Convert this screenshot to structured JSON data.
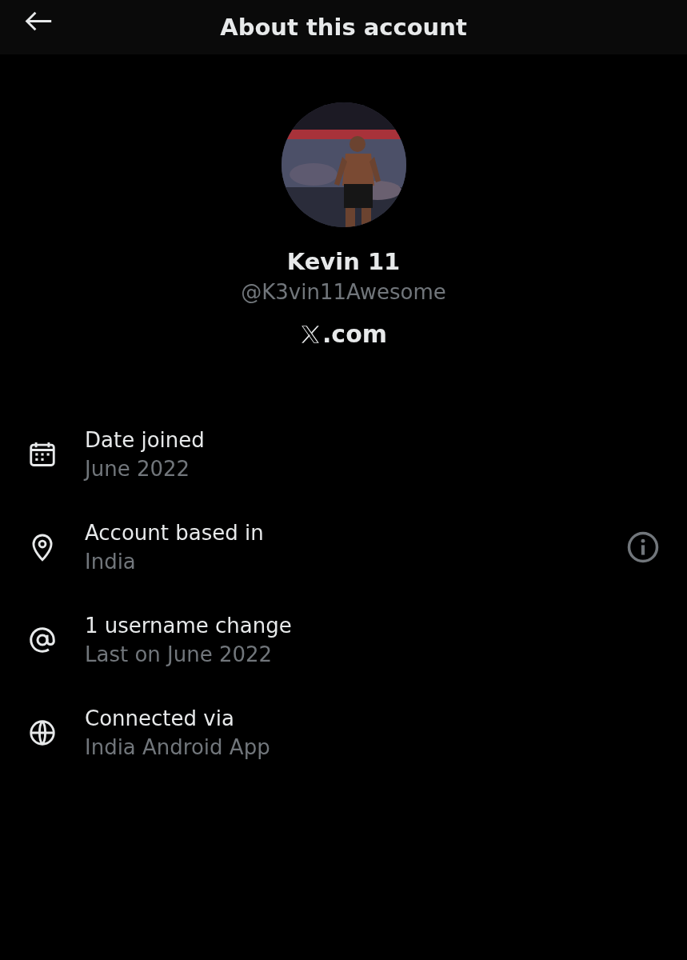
{
  "header": {
    "title": "About this account"
  },
  "profile": {
    "name": "Kevin 11",
    "handle": "@K3vin11Awesome",
    "site_suffix": ".com"
  },
  "details": [
    {
      "kind": "calendar",
      "title": "Date joined",
      "value": "June 2022",
      "info": false
    },
    {
      "kind": "pin",
      "title": "Account based in",
      "value": "India",
      "info": true
    },
    {
      "kind": "at",
      "title": "1 username change",
      "value": "Last on June 2022",
      "info": false
    },
    {
      "kind": "globe",
      "title": "Connected via",
      "value": "India Android App",
      "info": false
    }
  ]
}
